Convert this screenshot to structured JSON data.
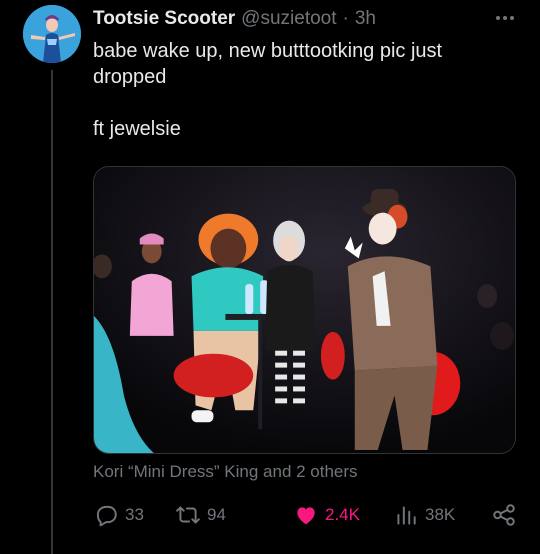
{
  "tweet": {
    "display_name": "Tootsie Scooter",
    "handle": "@suzietoot",
    "separator": "·",
    "time": "3h",
    "text_lines": [
      "babe wake up, new butttootking pic just",
      "dropped"
    ],
    "text_line_3": "ft jewelsie",
    "tagged": "Kori “Mini Dress” King and 2 others"
  },
  "actions": {
    "replies": "33",
    "reposts": "94",
    "likes": "2.4K",
    "views": "38K"
  },
  "icons": {
    "more": "more-horizontal-icon",
    "reply": "reply-icon",
    "repost": "repost-icon",
    "like": "heart-icon",
    "views": "views-icon",
    "share": "share-icon"
  },
  "colors": {
    "background": "#000000",
    "text": "#e7e9ea",
    "muted": "#71767b",
    "like": "#f91880",
    "border": "#2f3336"
  }
}
